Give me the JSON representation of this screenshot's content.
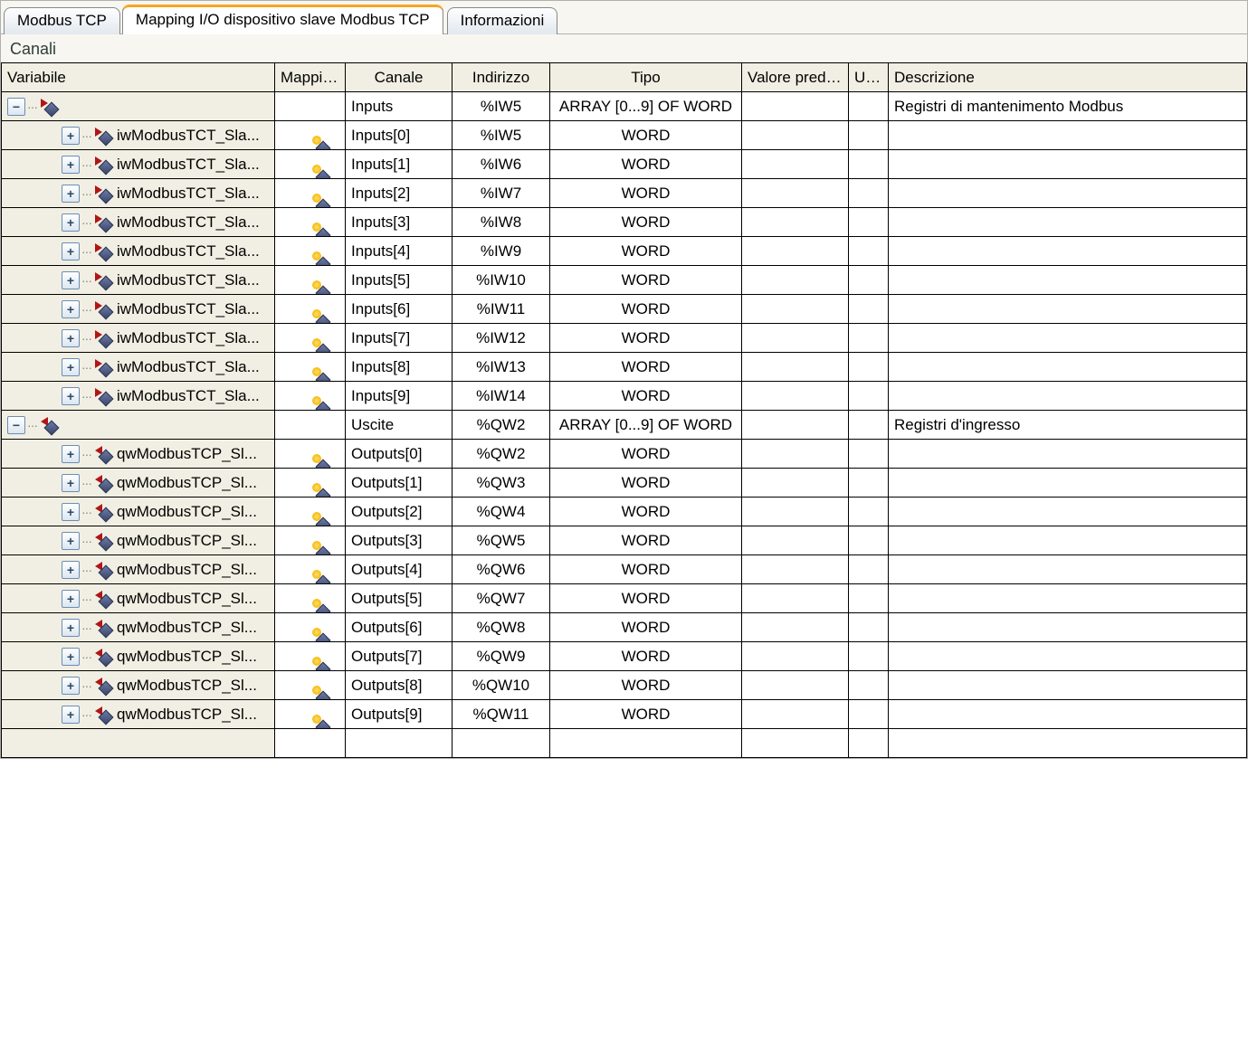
{
  "tabs": {
    "t1": "Modbus TCP",
    "t2": "Mapping I/O dispositivo slave Modbus TCP",
    "t3": "Informazioni"
  },
  "section_title": "Canali",
  "headers": {
    "variable": "Variabile",
    "mapping": "Mapping",
    "channel": "Canale",
    "address": "Indirizzo",
    "type": "Tipo",
    "default": "Valore predef.",
    "unit": "Unità",
    "description": "Descrizione"
  },
  "rows": [
    {
      "kind": "parent-in",
      "variable": "",
      "mappingIcon": false,
      "channel": "Inputs",
      "address": "%IW5",
      "type": "ARRAY [0...9] OF WORD",
      "default": "",
      "unit": "",
      "description": "Registri di mantenimento Modbus"
    },
    {
      "kind": "child-in",
      "variable": "iwModbusTCT_Sla...",
      "mappingIcon": true,
      "channel": "Inputs[0]",
      "address": "%IW5",
      "type": "WORD",
      "default": "",
      "unit": "",
      "description": ""
    },
    {
      "kind": "child-in",
      "variable": "iwModbusTCT_Sla...",
      "mappingIcon": true,
      "channel": "Inputs[1]",
      "address": "%IW6",
      "type": "WORD",
      "default": "",
      "unit": "",
      "description": ""
    },
    {
      "kind": "child-in",
      "variable": "iwModbusTCT_Sla...",
      "mappingIcon": true,
      "channel": "Inputs[2]",
      "address": "%IW7",
      "type": "WORD",
      "default": "",
      "unit": "",
      "description": ""
    },
    {
      "kind": "child-in",
      "variable": "iwModbusTCT_Sla...",
      "mappingIcon": true,
      "channel": "Inputs[3]",
      "address": "%IW8",
      "type": "WORD",
      "default": "",
      "unit": "",
      "description": ""
    },
    {
      "kind": "child-in",
      "variable": "iwModbusTCT_Sla...",
      "mappingIcon": true,
      "channel": "Inputs[4]",
      "address": "%IW9",
      "type": "WORD",
      "default": "",
      "unit": "",
      "description": ""
    },
    {
      "kind": "child-in",
      "variable": "iwModbusTCT_Sla...",
      "mappingIcon": true,
      "channel": "Inputs[5]",
      "address": "%IW10",
      "type": "WORD",
      "default": "",
      "unit": "",
      "description": ""
    },
    {
      "kind": "child-in",
      "variable": "iwModbusTCT_Sla...",
      "mappingIcon": true,
      "channel": "Inputs[6]",
      "address": "%IW11",
      "type": "WORD",
      "default": "",
      "unit": "",
      "description": ""
    },
    {
      "kind": "child-in",
      "variable": "iwModbusTCT_Sla...",
      "mappingIcon": true,
      "channel": "Inputs[7]",
      "address": "%IW12",
      "type": "WORD",
      "default": "",
      "unit": "",
      "description": ""
    },
    {
      "kind": "child-in",
      "variable": "iwModbusTCT_Sla...",
      "mappingIcon": true,
      "channel": "Inputs[8]",
      "address": "%IW13",
      "type": "WORD",
      "default": "",
      "unit": "",
      "description": ""
    },
    {
      "kind": "child-in",
      "variable": "iwModbusTCT_Sla...",
      "mappingIcon": true,
      "channel": "Inputs[9]",
      "address": "%IW14",
      "type": "WORD",
      "default": "",
      "unit": "",
      "description": ""
    },
    {
      "kind": "parent-out",
      "variable": "",
      "mappingIcon": false,
      "channel": "Uscite",
      "address": "%QW2",
      "type": "ARRAY [0...9] OF WORD",
      "default": "",
      "unit": "",
      "description": "Registri d'ingresso"
    },
    {
      "kind": "child-out",
      "variable": "qwModbusTCP_Sl...",
      "mappingIcon": true,
      "channel": "Outputs[0]",
      "address": "%QW2",
      "type": "WORD",
      "default": "",
      "unit": "",
      "description": ""
    },
    {
      "kind": "child-out",
      "variable": "qwModbusTCP_Sl...",
      "mappingIcon": true,
      "channel": "Outputs[1]",
      "address": "%QW3",
      "type": "WORD",
      "default": "",
      "unit": "",
      "description": ""
    },
    {
      "kind": "child-out",
      "variable": "qwModbusTCP_Sl...",
      "mappingIcon": true,
      "channel": "Outputs[2]",
      "address": "%QW4",
      "type": "WORD",
      "default": "",
      "unit": "",
      "description": ""
    },
    {
      "kind": "child-out",
      "variable": "qwModbusTCP_Sl...",
      "mappingIcon": true,
      "channel": "Outputs[3]",
      "address": "%QW5",
      "type": "WORD",
      "default": "",
      "unit": "",
      "description": ""
    },
    {
      "kind": "child-out",
      "variable": "qwModbusTCP_Sl...",
      "mappingIcon": true,
      "channel": "Outputs[4]",
      "address": "%QW6",
      "type": "WORD",
      "default": "",
      "unit": "",
      "description": ""
    },
    {
      "kind": "child-out",
      "variable": "qwModbusTCP_Sl...",
      "mappingIcon": true,
      "channel": "Outputs[5]",
      "address": "%QW7",
      "type": "WORD",
      "default": "",
      "unit": "",
      "description": ""
    },
    {
      "kind": "child-out",
      "variable": "qwModbusTCP_Sl...",
      "mappingIcon": true,
      "channel": "Outputs[6]",
      "address": "%QW8",
      "type": "WORD",
      "default": "",
      "unit": "",
      "description": ""
    },
    {
      "kind": "child-out",
      "variable": "qwModbusTCP_Sl...",
      "mappingIcon": true,
      "channel": "Outputs[7]",
      "address": "%QW9",
      "type": "WORD",
      "default": "",
      "unit": "",
      "description": ""
    },
    {
      "kind": "child-out",
      "variable": "qwModbusTCP_Sl...",
      "mappingIcon": true,
      "channel": "Outputs[8]",
      "address": "%QW10",
      "type": "WORD",
      "default": "",
      "unit": "",
      "description": ""
    },
    {
      "kind": "child-out",
      "variable": "qwModbusTCP_Sl...",
      "mappingIcon": true,
      "channel": "Outputs[9]",
      "address": "%QW11",
      "type": "WORD",
      "default": "",
      "unit": "",
      "description": ""
    }
  ]
}
